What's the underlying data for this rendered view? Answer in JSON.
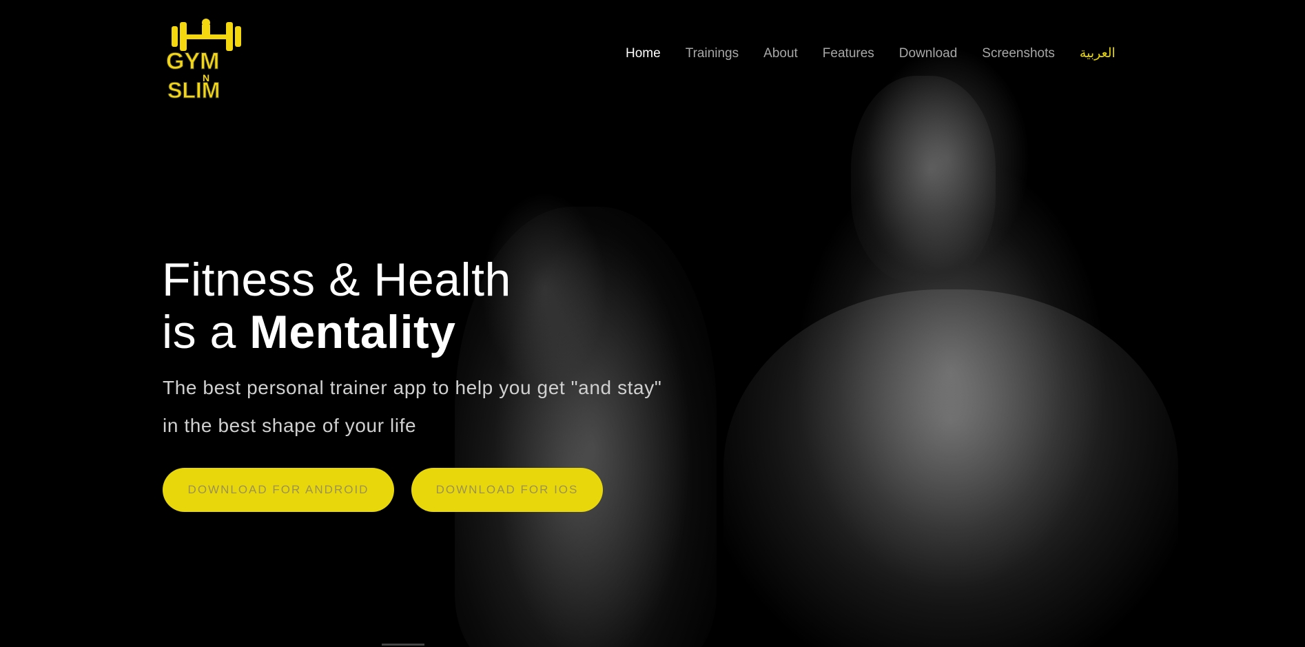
{
  "logo": {
    "text_line1": "GYM",
    "text_line2": "N",
    "text_line3": "SLIM",
    "color": "#f5d70f"
  },
  "nav": {
    "items": [
      {
        "label": "Home",
        "active": true
      },
      {
        "label": "Trainings",
        "active": false
      },
      {
        "label": "About",
        "active": false
      },
      {
        "label": "Features",
        "active": false
      },
      {
        "label": "Download",
        "active": false
      },
      {
        "label": "Screenshots",
        "active": false
      }
    ],
    "language": "العربية"
  },
  "hero": {
    "title_line1": "Fitness & Health",
    "title_line2_prefix": "is a ",
    "title_line2_bold": "Mentality",
    "subtitle_line1": "The best personal trainer app to help you get \"and stay\"",
    "subtitle_line2": "in the best shape of your life"
  },
  "buttons": {
    "android": "DOWNLOAD FOR ANDROID",
    "ios": "DOWNLOAD FOR IOS"
  },
  "colors": {
    "accent": "#e8d80b",
    "background": "#000000",
    "nav_text": "#a8a8a8",
    "nav_active": "#ffffff"
  }
}
